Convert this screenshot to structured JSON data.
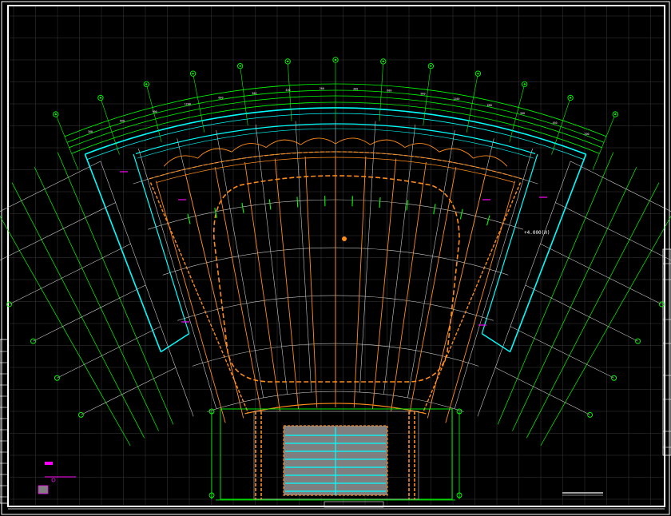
{
  "drawing": {
    "elevation_label": "+4.000(H)",
    "colors": {
      "background": "#000000",
      "frame": "#ffffff",
      "grid": "#3a3a3a",
      "dimension": "#00ff00",
      "cyan_wall": "#00ffff",
      "orange_structure": "#ff8c1a",
      "radial_axis": "#c8c8c8",
      "magenta_mark": "#ff00ff",
      "stairs_fill": "#7f7f7f"
    },
    "axis_count_top": 13,
    "dimension_marks": [
      "300",
      "600",
      "900",
      "1200",
      "600",
      "300",
      "450",
      "200"
    ]
  }
}
